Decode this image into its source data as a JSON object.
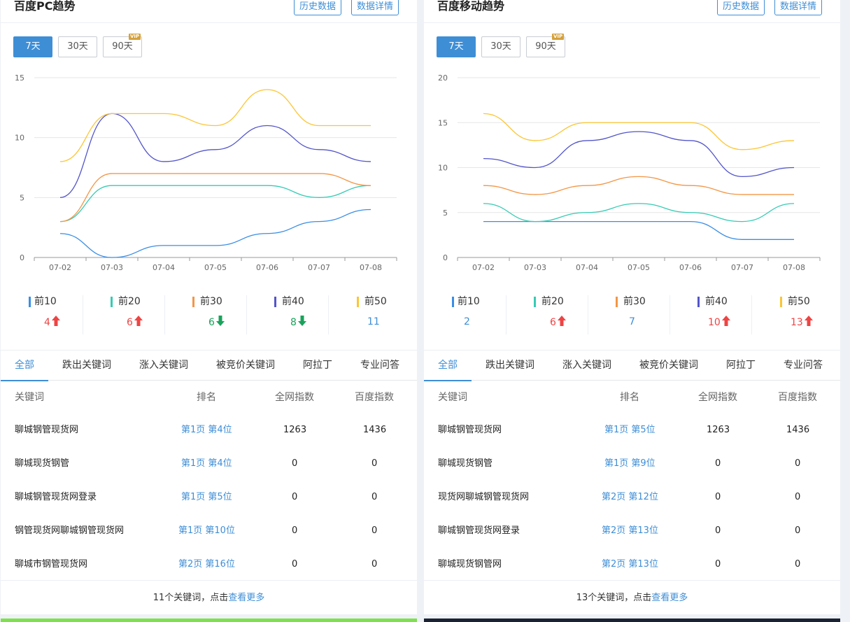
{
  "colors": {
    "accent": "#3e8ed6",
    "top10": "#3a8ee6",
    "top20": "#36cbb4",
    "top30": "#f39646",
    "top40": "#5355c9",
    "top50": "#fcc534",
    "up": "#ee4444",
    "down": "#1aa25b",
    "neutral": "#3e8ed6"
  },
  "panels": [
    {
      "title": "百度PC趋势",
      "history_btn": "历史数据",
      "detail_btn": "数据详情",
      "ranges": [
        "7天",
        "30天",
        "90天"
      ],
      "vip_label": "VIP",
      "chart_data": {
        "type": "line",
        "categories": [
          "07-02",
          "07-03",
          "07-04",
          "07-05",
          "07-06",
          "07-07",
          "07-08"
        ],
        "yticks": [
          "0",
          "5",
          "10",
          "15"
        ],
        "ylim": [
          0,
          15
        ],
        "grid": true,
        "series": [
          {
            "name": "前10",
            "color": "#3a8ee6",
            "values": [
              2,
              0,
              1,
              1,
              2,
              3,
              4
            ]
          },
          {
            "name": "前20",
            "color": "#36cbb4",
            "values": [
              3,
              6,
              6,
              6,
              6,
              5,
              6
            ]
          },
          {
            "name": "前30",
            "color": "#f39646",
            "values": [
              3,
              7,
              7,
              7,
              7,
              7,
              6
            ]
          },
          {
            "name": "前40",
            "color": "#5355c9",
            "values": [
              5,
              12,
              8,
              9,
              11,
              9,
              8
            ]
          },
          {
            "name": "前50",
            "color": "#fcc534",
            "values": [
              8,
              12,
              12,
              11,
              14,
              11,
              11
            ]
          }
        ]
      },
      "legend": [
        {
          "label": "前10",
          "value": "4",
          "trend": "up"
        },
        {
          "label": "前20",
          "value": "6",
          "trend": "up"
        },
        {
          "label": "前30",
          "value": "6",
          "trend": "down"
        },
        {
          "label": "前40",
          "value": "8",
          "trend": "down"
        },
        {
          "label": "前50",
          "value": "11",
          "trend": "none"
        }
      ],
      "tabs": [
        "全部",
        "跌出关键词",
        "涨入关键词",
        "被竞价关键词",
        "阿拉丁",
        "专业问答"
      ],
      "columns": [
        "关键词",
        "排名",
        "全网指数",
        "百度指数"
      ],
      "rows": [
        {
          "kw": "聊城钢管现货网",
          "rank": "第1页 第4位",
          "all": "1263",
          "baidu": "1436"
        },
        {
          "kw": "聊城现货钢管",
          "rank": "第1页 第4位",
          "all": "0",
          "baidu": "0"
        },
        {
          "kw": "聊城钢管现货网登录",
          "rank": "第1页 第5位",
          "all": "0",
          "baidu": "0"
        },
        {
          "kw": "钢管现货网聊城钢管现货网",
          "rank": "第1页 第10位",
          "all": "0",
          "baidu": "0"
        },
        {
          "kw": "聊城市钢管现货网",
          "rank": "第2页 第16位",
          "all": "0",
          "baidu": "0"
        }
      ],
      "footer_text": "11个关键词，点击",
      "footer_link": "查看更多"
    },
    {
      "title": "百度移动趋势",
      "history_btn": "历史数据",
      "detail_btn": "数据详情",
      "ranges": [
        "7天",
        "30天",
        "90天"
      ],
      "vip_label": "VIP",
      "chart_data": {
        "type": "line",
        "categories": [
          "07-02",
          "07-03",
          "07-04",
          "07-05",
          "07-06",
          "07-07",
          "07-08"
        ],
        "yticks": [
          "0",
          "5",
          "10",
          "15",
          "20"
        ],
        "ylim": [
          0,
          20
        ],
        "grid": true,
        "series": [
          {
            "name": "前10",
            "color": "#3a8ee6",
            "values": [
              4,
              4,
              4,
              4,
              4,
              2,
              2
            ]
          },
          {
            "name": "前20",
            "color": "#36cbb4",
            "values": [
              6,
              4,
              5,
              6,
              5,
              4,
              6
            ]
          },
          {
            "name": "前30",
            "color": "#f39646",
            "values": [
              8,
              7,
              8,
              9,
              8,
              7,
              7
            ]
          },
          {
            "name": "前40",
            "color": "#5355c9",
            "values": [
              11,
              10,
              13,
              14,
              13,
              9,
              10
            ]
          },
          {
            "name": "前50",
            "color": "#fcc534",
            "values": [
              16,
              13,
              15,
              15,
              15,
              12,
              13
            ]
          }
        ]
      },
      "legend": [
        {
          "label": "前10",
          "value": "2",
          "trend": "none"
        },
        {
          "label": "前20",
          "value": "6",
          "trend": "up"
        },
        {
          "label": "前30",
          "value": "7",
          "trend": "none"
        },
        {
          "label": "前40",
          "value": "10",
          "trend": "up"
        },
        {
          "label": "前50",
          "value": "13",
          "trend": "up"
        }
      ],
      "tabs": [
        "全部",
        "跌出关键词",
        "涨入关键词",
        "被竞价关键词",
        "阿拉丁",
        "专业问答"
      ],
      "columns": [
        "关键词",
        "排名",
        "全网指数",
        "百度指数"
      ],
      "rows": [
        {
          "kw": "聊城钢管现货网",
          "rank": "第1页 第5位",
          "all": "1263",
          "baidu": "1436"
        },
        {
          "kw": "聊城现货钢管",
          "rank": "第1页 第9位",
          "all": "0",
          "baidu": "0"
        },
        {
          "kw": "现货网聊城钢管现货网",
          "rank": "第2页 第12位",
          "all": "0",
          "baidu": "0"
        },
        {
          "kw": "聊城钢管现货网登录",
          "rank": "第2页 第13位",
          "all": "0",
          "baidu": "0"
        },
        {
          "kw": "聊城现货钢管网",
          "rank": "第2页 第13位",
          "all": "0",
          "baidu": "0"
        }
      ],
      "footer_text": "13个关键词，点击",
      "footer_link": "查看更多"
    }
  ]
}
